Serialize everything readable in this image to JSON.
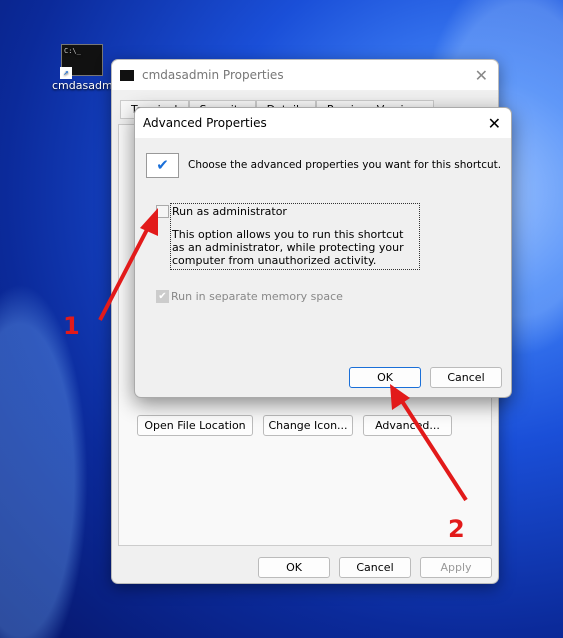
{
  "desktop": {
    "icon_label": "cmdasadmin",
    "icon_text": "C:\\_"
  },
  "properties": {
    "title": "cmdasadmin Properties",
    "tabs": [
      "Terminal",
      "Security",
      "Details",
      "Previous Versions"
    ],
    "buttons": {
      "open_file_location": "Open File Location",
      "change_icon": "Change Icon...",
      "advanced": "Advanced...",
      "ok": "OK",
      "cancel": "Cancel",
      "apply": "Apply"
    }
  },
  "advanced": {
    "title": "Advanced Properties",
    "intro": "Choose the advanced properties you want for this shortcut.",
    "run_as_admin": {
      "label": "Run as administrator",
      "checked": false
    },
    "description": "This option allows you to run this shortcut as an administrator, while protecting your computer from unauthorized activity.",
    "separate_memory": {
      "label": "Run in separate memory space",
      "checked": true,
      "disabled": true
    },
    "ok": "OK",
    "cancel": "Cancel"
  },
  "annotations": {
    "step1": "1",
    "step2": "2",
    "arrow_color": "#e21a1a"
  }
}
